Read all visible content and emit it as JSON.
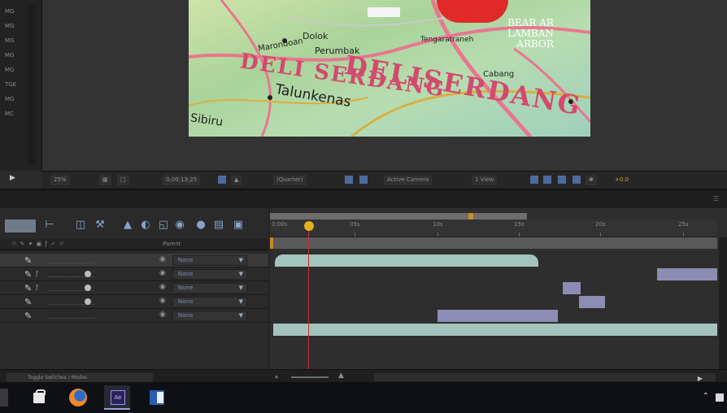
{
  "left_tools": {
    "items": [
      "MG",
      "MG",
      "MG",
      "MG",
      "MG",
      "TGE",
      "MG",
      "MC"
    ]
  },
  "map": {
    "labels": [
      "Deli Serdang",
      "Dolok",
      "Perumbak",
      "Marondoan",
      "Tengaratraneh",
      "Cabang",
      "Talunkenas",
      "Sibiru"
    ],
    "big_text": [
      "DELI SERDANG",
      "DELISERDANG"
    ],
    "corner_text": "BEAR AR\nLAMBAN\nARBOR"
  },
  "viewer_toolbar": {
    "zoom": "25%",
    "timecode": "0;00;13;25",
    "resolution": "(Quarter)",
    "camera": "Active Camera",
    "views": "1 View",
    "exposure": "+0.0"
  },
  "timeline": {
    "ruler_ticks": [
      "0:00s",
      "05s",
      "10s",
      "15s",
      "20s",
      "25s"
    ],
    "header": {
      "switches": "☉ ✎ ✦ ▣ ƒ ✓ ☉",
      "parent": "Parent"
    },
    "layers": [
      {
        "parent": "None",
        "has_fx": false,
        "has_solo": false
      },
      {
        "parent": "None",
        "has_fx": true,
        "has_solo": true
      },
      {
        "parent": "None",
        "has_fx": true,
        "has_solo": true
      },
      {
        "parent": "None",
        "has_fx": false,
        "has_solo": true
      },
      {
        "parent": "None",
        "has_fx": false,
        "has_solo": false
      }
    ],
    "toggle_label": "Toggle Switches / Modes"
  },
  "colors": {
    "teal_bar": "#a3c4bd",
    "lavender_bar": "#8d8cb4",
    "playhead": "#c03232",
    "cti_head": "#e2b020"
  },
  "taskbar": {
    "apps": [
      "store-icon",
      "firefox-icon",
      "after-effects-icon",
      "word-icon"
    ],
    "ae_label": "Ae"
  }
}
